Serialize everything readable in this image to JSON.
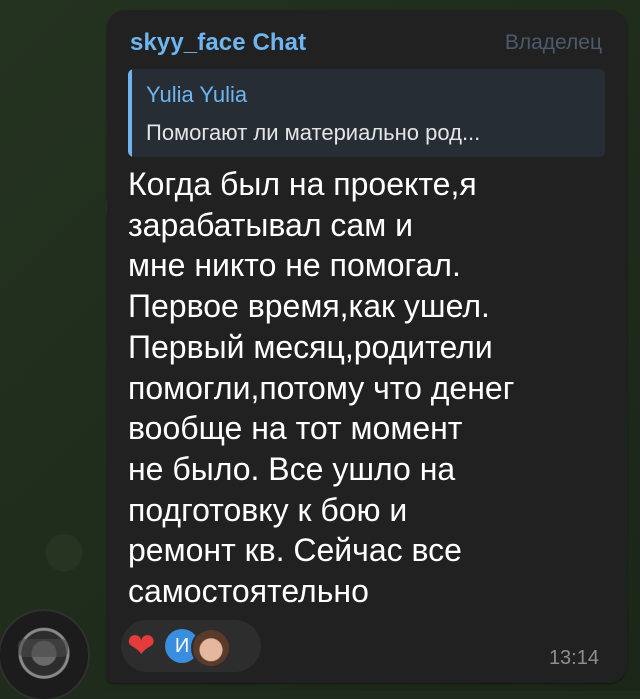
{
  "chat_message": {
    "sender": "skyy_face Chat",
    "role_badge": "Владелец",
    "reply": {
      "author": "Yulia Yulia",
      "text": "Помогают ли материально род..."
    },
    "text": "Когда был на проекте,я\nзарабатывал сам и\nмне никто не помогал.\nПервое время,как ушел.\nПервый месяц,родители\nпомогли,потому что денег\nвообще на тот момент\nне было. Все ушло на\nподготовку к бою и\nремонт кв. Сейчас все\nсамостоятельно",
    "reactions": {
      "emoji_icon": "heart-icon",
      "reactor_initial": "И"
    },
    "time": "13:14"
  },
  "colors": {
    "sender_name": "#6fb5f0",
    "bubble_bg": "#212121",
    "badge": "#4d5a6d",
    "heart": "#e53b3b"
  }
}
